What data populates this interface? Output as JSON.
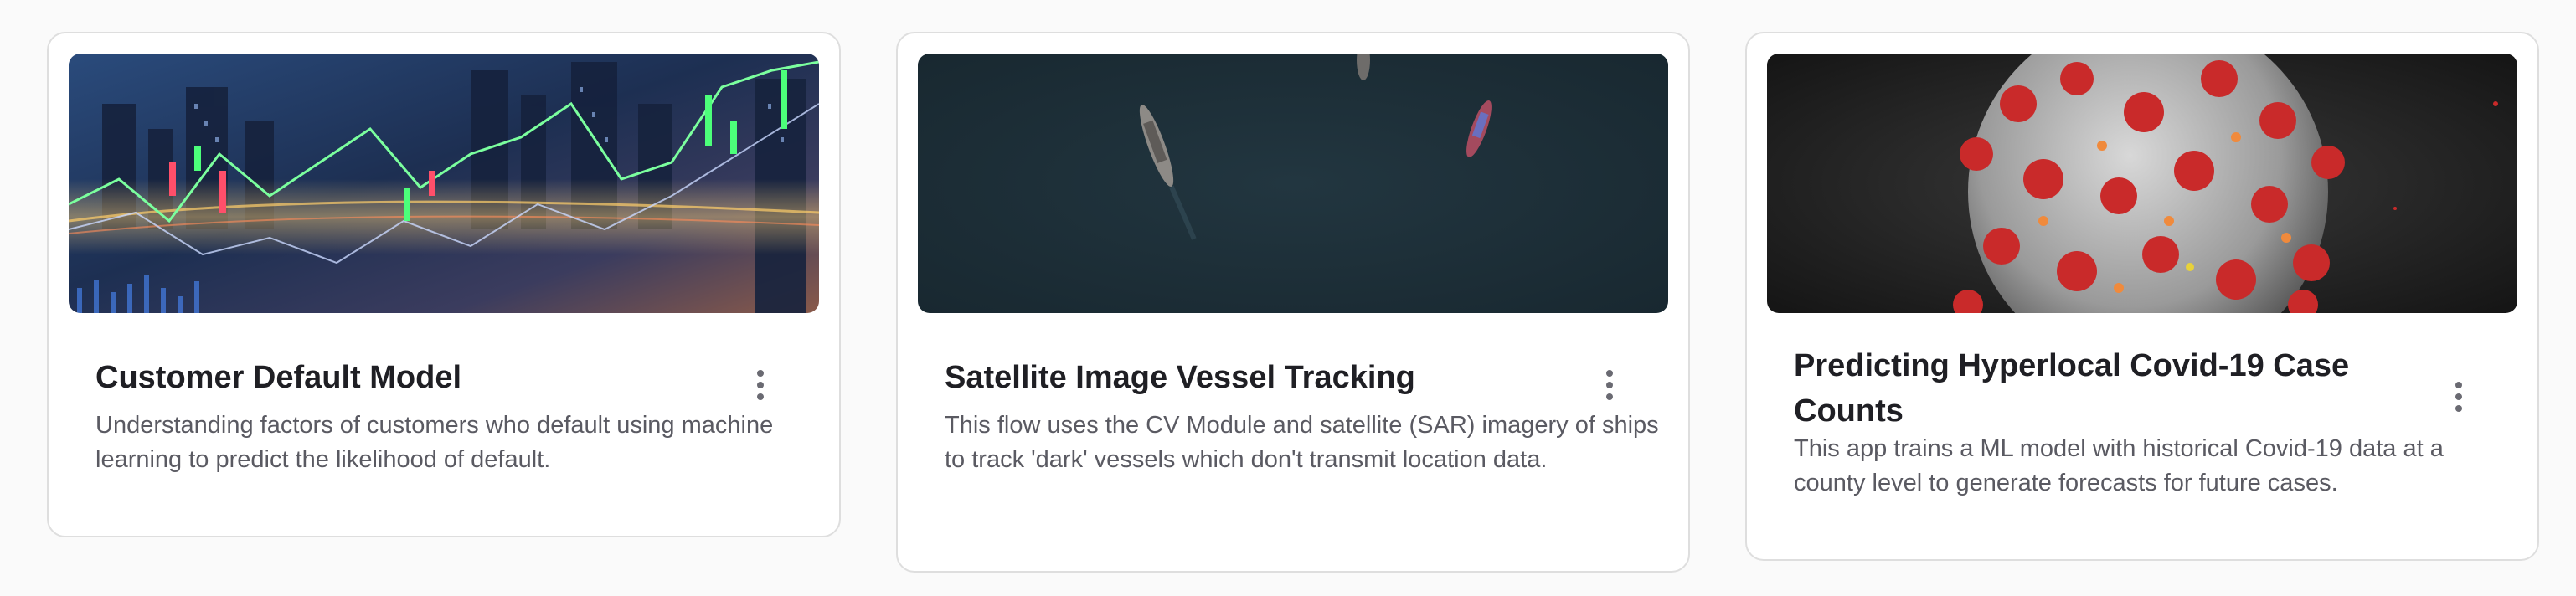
{
  "cards": [
    {
      "title": "Customer Default Model",
      "description": "Understanding factors of customers who default using machine learning to predict the likelihood of default.",
      "image": "city-skyline-financial-chart"
    },
    {
      "title": "Satellite Image Vessel Tracking",
      "description": "This flow uses the CV Module and satellite (SAR) imagery of ships to track 'dark' vessels which don't transmit location data.",
      "image": "aerial-ocean-ships"
    },
    {
      "title": "Predicting Hyperlocal Covid-19 Case Counts",
      "description": "This app trains a ML model with historical Covid-19 data at a county level to generate forecasts for future cases.",
      "image": "covid-virus-particle"
    }
  ],
  "icons": {
    "menu": "more-vertical-icon"
  },
  "colors": {
    "page_background": "#fafafa",
    "card_border": "#dedede",
    "title": "#1f1f24",
    "description": "#5a5a62"
  }
}
